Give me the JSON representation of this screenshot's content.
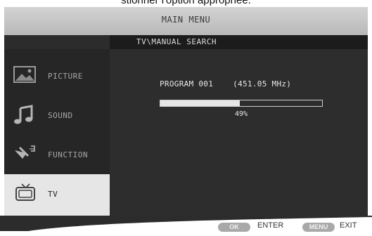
{
  "caption": "stionner l'option appropriée.",
  "header": {
    "title": "MAIN MENU"
  },
  "breadcrumb": "TV\\MANUAL SEARCH",
  "sidebar": {
    "items": [
      {
        "label": "PICTURE",
        "icon": "picture-icon"
      },
      {
        "label": "SOUND",
        "icon": "music-note-icon"
      },
      {
        "label": "FUNCTION",
        "icon": "function-icon"
      },
      {
        "label": "TV",
        "icon": "tv-icon",
        "selected": true
      }
    ]
  },
  "search": {
    "program": "PROGRAM 001",
    "frequency": "(451.05 MHz)",
    "progress": 0.49,
    "progress_text": "49%"
  },
  "footer": {
    "ok_key": "OK",
    "ok_label": "ENTER",
    "menu_key": "MENU",
    "menu_label": "EXIT"
  },
  "colors": {
    "highlight": "#e6e6e6",
    "screen_bg": "#2c2c2c",
    "titlebar": "#c8c8c8"
  }
}
